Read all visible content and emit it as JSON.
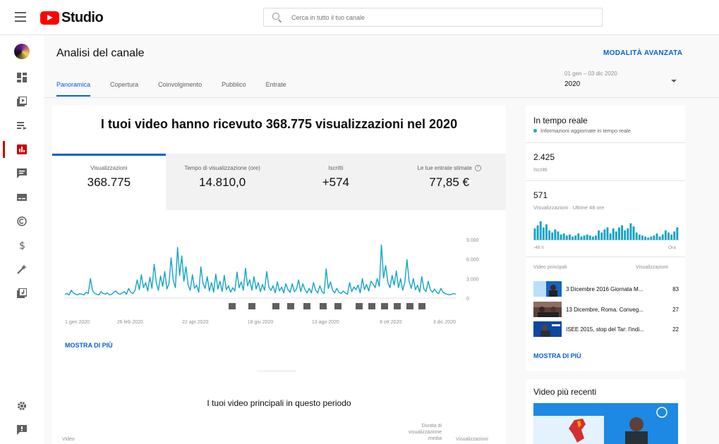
{
  "app": {
    "logo_text": "Studio"
  },
  "search": {
    "placeholder": "Cerca in tutto il tuo canale"
  },
  "sidebar": {
    "items": [
      "dashboard",
      "content",
      "playlists",
      "analytics",
      "comments",
      "subtitles",
      "copyright",
      "monetization",
      "customization",
      "audio-library",
      "settings",
      "feedback"
    ],
    "active": "analytics"
  },
  "header": {
    "title": "Analisi del canale",
    "advanced_mode": "MODALITÀ AVANZATA"
  },
  "tabs": [
    {
      "label": "Panoramica",
      "active": true
    },
    {
      "label": "Copertura",
      "active": false
    },
    {
      "label": "Coinvolgimento",
      "active": false
    },
    {
      "label": "Pubblico",
      "active": false
    },
    {
      "label": "Entrate",
      "active": false
    }
  ],
  "period": {
    "range": "01 gen – 03 dic 2020",
    "value": "2020"
  },
  "main": {
    "headline": "I tuoi video hanno ricevuto 368.775 visualizzazioni nel 2020",
    "metrics": [
      {
        "label": "Visualizzazioni",
        "value": "368.775",
        "active": true
      },
      {
        "label": "Tempo di visualizzazione (ore)",
        "value": "14.810,0",
        "active": false
      },
      {
        "label": "Iscritti",
        "value": "+574",
        "active": false
      },
      {
        "label": "Le tue entrate stimate",
        "value": "77,85 €",
        "active": false,
        "info": true
      }
    ],
    "show_more": "MOSTRA DI PIÙ",
    "top_videos_title": "I tuoi video principali in questo periodo",
    "columns": {
      "video": "Video",
      "duration": "Durata di visualizzazione media",
      "views": "Visualizzazioni"
    }
  },
  "chart_data": {
    "type": "line",
    "x_ticks": [
      "1 gen 2020",
      "26 feb 2020",
      "22 apr 2020",
      "18 giu 2020",
      "13 ago 2020",
      "8 ott 2020",
      "3 dic 2020"
    ],
    "y_ticks": [
      "9.000",
      "6.000",
      "3.000",
      "0"
    ],
    "ylim": [
      0,
      9000
    ],
    "color": "#12a4c5",
    "series": [
      {
        "values": [
          600,
          700,
          500,
          1200,
          800,
          600,
          500,
          700,
          600,
          500,
          900,
          700,
          3000,
          1200,
          700,
          600,
          500,
          1000,
          700,
          600,
          800,
          500,
          600,
          900,
          1100,
          700,
          600,
          800,
          1000,
          600,
          1500,
          900,
          700,
          1200,
          2800,
          1300,
          3600,
          1600,
          2400,
          1100,
          3200,
          1500,
          5200,
          2400,
          1200,
          3400,
          1800,
          4100,
          1400,
          2200,
          6200,
          2700,
          1600,
          7800,
          3500,
          6500,
          2600,
          4800,
          2000,
          1200,
          3600,
          1500,
          2000,
          900,
          4800,
          2300,
          1500,
          3300,
          1100,
          2400,
          900,
          3700,
          1400,
          2600,
          1000,
          3500,
          1300,
          1900,
          900,
          1600,
          1100,
          4000,
          1600,
          2500,
          1200,
          4600,
          1900,
          2800,
          1200,
          3300,
          1400,
          2400,
          1000,
          2100,
          1200,
          4100,
          1700,
          1200,
          1900,
          800,
          2500,
          1100,
          1700,
          800,
          2200,
          1300,
          900,
          2200,
          1000,
          1400,
          2800,
          1000,
          2200,
          1300,
          800,
          1500,
          800,
          2400,
          1200,
          800,
          1900,
          1000,
          700,
          4500,
          1500,
          2500,
          1200,
          800,
          1500,
          900,
          700,
          1100,
          800,
          600,
          2400,
          1000,
          1700,
          1300,
          2000,
          800,
          3000,
          1300,
          2100,
          1100,
          2600,
          2200,
          1600,
          3000,
          1800,
          8200,
          3100,
          5000,
          2400,
          1600,
          3500,
          2000,
          4200,
          1600,
          3000,
          1200,
          2400,
          5900,
          2600,
          1500,
          3000,
          1300,
          2000,
          900,
          3300,
          1400,
          1000,
          2600,
          1300,
          900,
          1400,
          900,
          700,
          1500,
          900,
          700,
          600,
          500,
          600,
          700,
          600
        ]
      }
    ]
  },
  "realtime": {
    "title": "In tempo reale",
    "subtitle": "Informazioni aggiornate in tempo reale",
    "subscribers_value": "2.425",
    "subscribers_label": "Iscritti",
    "views_value": "571",
    "views_label": "Visualizzazioni · Ultime 48 ore",
    "axis_left": "-48 h",
    "axis_right": "Ora",
    "bar_color": "#12a4c5",
    "bars": [
      11,
      14,
      18,
      12,
      15,
      9,
      7,
      10,
      8,
      5,
      6,
      4,
      5,
      3,
      4,
      6,
      3,
      4,
      5,
      4,
      3,
      4,
      9,
      7,
      10,
      12,
      6,
      11,
      8,
      12,
      14,
      9,
      11,
      16,
      13,
      7,
      5,
      4,
      3,
      2,
      3,
      4,
      6,
      3,
      5,
      9,
      7,
      5,
      8,
      12
    ],
    "col_video": "Video principali",
    "col_views": "Visualizzazioni",
    "videos": [
      {
        "title": "3 Dicembre 2016 Giornata M...",
        "views": "83"
      },
      {
        "title": "13 Dicembre, Roma. Conveg...",
        "views": "27"
      },
      {
        "title": "ISEE 2015, stop del Tar: l'indi...",
        "views": "22"
      }
    ],
    "show_more": "MOSTRA DI PIÙ"
  },
  "recent": {
    "title": "Video più recenti"
  }
}
